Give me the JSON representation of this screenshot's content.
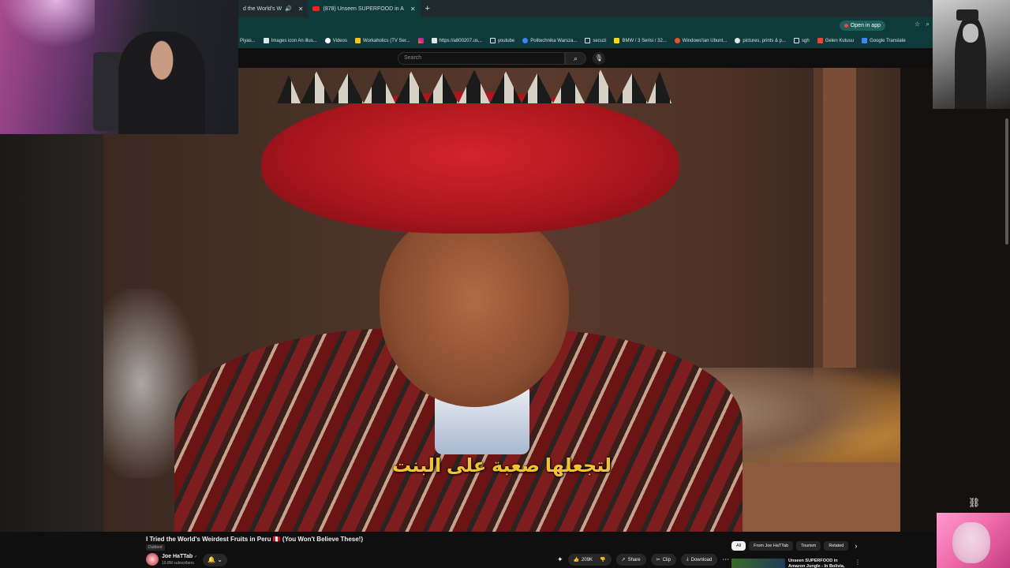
{
  "tabs": [
    {
      "label": "d the World's W",
      "active": false,
      "audio_icon": "speaker-icon"
    },
    {
      "label": "(878) Unseen SUPERFOOD in A",
      "active": true
    }
  ],
  "new_tab": "+",
  "toolbar": {
    "open_in_app": "Open in app"
  },
  "bookmarks": [
    {
      "label": "Piyas...",
      "icon": "bookmark",
      "color": "#ffffff"
    },
    {
      "label": "Images icon An illus...",
      "icon": "file",
      "color": "#dfe6ea"
    },
    {
      "label": "Videos",
      "icon": "google",
      "color": "#ffffff"
    },
    {
      "label": "Workaholics (TV Ser...",
      "icon": "imdb",
      "color": "#f5c518"
    },
    {
      "label": "https://a800207.us...",
      "icon": "file",
      "color": "#dfe6ea"
    },
    {
      "label": "youtube",
      "icon": "folder",
      "color": "#dfe6ea"
    },
    {
      "label": "Politechnika Warsza...",
      "icon": "globe",
      "color": "#3b82f6"
    },
    {
      "label": "secuzi",
      "icon": "folder",
      "color": "#dfe6ea"
    },
    {
      "label": "BMW / 3 Serisi / 32...",
      "icon": "s-logo",
      "color": "#f5d90a"
    },
    {
      "label": "Windows'tan Ubunt...",
      "icon": "ubuntu",
      "color": "#e95420"
    },
    {
      "label": "pictures, prints & p...",
      "icon": "pin",
      "color": "#dfe6ea"
    },
    {
      "label": "sgh",
      "icon": "folder",
      "color": "#dfe6ea"
    },
    {
      "label": "Gelen Kutusu",
      "icon": "gmail",
      "color": "#ea4335"
    },
    {
      "label": "Google Translate",
      "icon": "translate",
      "color": "#4285f4"
    }
  ],
  "search": {
    "placeholder": "Search"
  },
  "video": {
    "subtitle": "لتجعلها صعبة على البنت"
  },
  "info": {
    "title": "I Tried the World's Weirdest Fruits in Peru 🇵🇪 (You Won't Believe These!)",
    "dubbed": "Dubbed",
    "channel": "Joe HaTTab",
    "verified": "✓",
    "subscribers": "19.8M subscribers",
    "likes": "209K",
    "share": "Share",
    "clip": "Clip",
    "download": "Download"
  },
  "chips": [
    "All",
    "From Joe HaTTab",
    "Tourism",
    "Related"
  ],
  "recommendation": {
    "title": "Unseen SUPERFOOD in Amazon Jungle - In Bolivia, Brazil or..."
  }
}
